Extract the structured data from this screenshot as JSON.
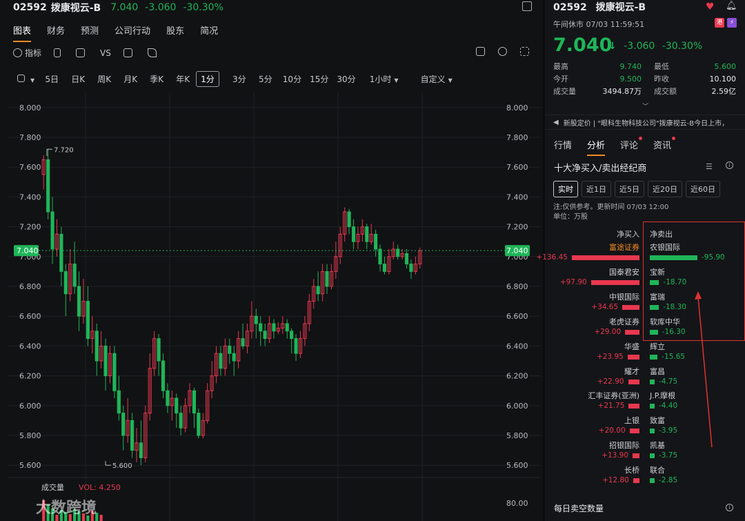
{
  "header": {
    "code": "02592",
    "name": "拨康视云-B",
    "price": "7.040",
    "change": "-3.060",
    "change_pct": "-30.30%"
  },
  "tabs": [
    "图表",
    "财务",
    "预测",
    "公司行动",
    "股东",
    "简况"
  ],
  "toolbar": {
    "indicator": "指标",
    "vs": "VS"
  },
  "periods": {
    "items": [
      "5日",
      "日K",
      "周K",
      "月K",
      "季K",
      "年K",
      "1分",
      "3分",
      "5分",
      "10分",
      "15分",
      "30分",
      "1小时"
    ],
    "active": "1分",
    "custom": "自定义"
  },
  "chart_data": {
    "type": "candlestick",
    "y_ticks": [
      "8.000",
      "7.800",
      "7.600",
      "7.400",
      "7.200",
      "7.000",
      "6.800",
      "6.600",
      "6.400",
      "6.200",
      "6.000",
      "5.800",
      "5.600"
    ],
    "ylim": [
      5.55,
      8.05
    ],
    "last_price_label": "7.040",
    "last_price": 7.04,
    "high_label": "7.720",
    "high": 7.72,
    "low_label": "5.600",
    "low": 5.6,
    "volume_label": "成交量",
    "volume_value": "VOL: 4.250",
    "volume_tick": "80.00",
    "candles": [
      [
        7.55,
        7.65,
        7.68,
        7.45
      ],
      [
        7.65,
        7.3,
        7.72,
        7.25
      ],
      [
        7.3,
        7.05,
        7.4,
        6.95
      ],
      [
        7.05,
        7.15,
        7.25,
        7.0
      ],
      [
        7.15,
        6.9,
        7.2,
        6.8
      ],
      [
        6.9,
        6.75,
        6.95,
        6.6
      ],
      [
        6.75,
        6.95,
        7.05,
        6.7
      ],
      [
        6.95,
        6.8,
        7.1,
        6.75
      ],
      [
        6.8,
        6.6,
        6.9,
        6.5
      ],
      [
        6.6,
        6.7,
        6.85,
        6.55
      ],
      [
        6.7,
        6.45,
        6.8,
        6.4
      ],
      [
        6.45,
        6.5,
        6.6,
        6.35
      ],
      [
        6.5,
        6.3,
        6.55,
        6.2
      ],
      [
        6.3,
        6.4,
        6.5,
        6.25
      ],
      [
        6.4,
        6.2,
        6.45,
        6.1
      ],
      [
        6.2,
        6.35,
        6.4,
        6.15
      ],
      [
        6.35,
        6.1,
        6.4,
        6.05
      ],
      [
        6.1,
        5.95,
        6.2,
        5.9
      ],
      [
        5.95,
        5.8,
        6.0,
        5.7
      ],
      [
        5.8,
        5.9,
        6.05,
        5.75
      ],
      [
        5.9,
        5.7,
        5.95,
        5.65
      ],
      [
        5.7,
        5.75,
        5.85,
        5.62
      ],
      [
        5.75,
        5.65,
        5.9,
        5.6
      ],
      [
        5.65,
        5.95,
        6.0,
        5.62
      ],
      [
        5.95,
        6.25,
        6.35,
        5.9
      ],
      [
        6.25,
        6.45,
        6.5,
        6.2
      ],
      [
        6.45,
        6.3,
        6.48,
        6.2
      ],
      [
        6.3,
        6.1,
        6.35,
        6.05
      ],
      [
        6.1,
        6.0,
        6.15,
        5.95
      ],
      [
        6.0,
        6.05,
        6.1,
        5.9
      ],
      [
        6.05,
        5.95,
        6.08,
        5.85
      ],
      [
        5.95,
        5.85,
        6.0,
        5.8
      ],
      [
        5.85,
        6.0,
        6.05,
        5.82
      ],
      [
        6.0,
        6.1,
        6.15,
        5.95
      ],
      [
        6.1,
        5.95,
        6.12,
        5.85
      ],
      [
        5.95,
        5.8,
        5.98,
        5.78
      ],
      [
        5.8,
        5.9,
        5.95,
        5.78
      ],
      [
        5.9,
        6.1,
        6.15,
        5.88
      ],
      [
        6.1,
        6.2,
        6.3,
        6.05
      ],
      [
        6.2,
        6.35,
        6.4,
        6.15
      ],
      [
        6.35,
        6.25,
        6.4,
        6.2
      ],
      [
        6.25,
        6.4,
        6.45,
        6.2
      ],
      [
        6.4,
        6.35,
        6.45,
        6.28
      ],
      [
        6.35,
        6.3,
        6.4,
        6.2
      ],
      [
        6.3,
        6.45,
        6.5,
        6.25
      ],
      [
        6.45,
        6.4,
        6.55,
        6.38
      ],
      [
        6.4,
        6.5,
        6.55,
        6.35
      ],
      [
        6.5,
        6.6,
        6.7,
        6.45
      ],
      [
        6.6,
        6.55,
        6.65,
        6.45
      ],
      [
        6.55,
        6.5,
        6.6,
        6.4
      ],
      [
        6.5,
        6.45,
        6.55,
        6.4
      ],
      [
        6.45,
        6.55,
        6.6,
        6.42
      ],
      [
        6.55,
        6.5,
        6.58,
        6.45
      ],
      [
        6.5,
        6.52,
        6.56,
        6.48
      ],
      [
        6.52,
        6.55,
        6.6,
        6.48
      ],
      [
        6.55,
        6.5,
        6.58,
        6.45
      ],
      [
        6.5,
        6.45,
        6.52,
        6.35
      ],
      [
        6.45,
        6.35,
        6.48,
        6.3
      ],
      [
        6.35,
        6.45,
        6.5,
        6.32
      ],
      [
        6.45,
        6.55,
        6.6,
        6.4
      ],
      [
        6.55,
        6.7,
        6.75,
        6.5
      ],
      [
        6.7,
        6.8,
        6.85,
        6.65
      ],
      [
        6.8,
        6.75,
        6.9,
        6.7
      ],
      [
        6.75,
        6.9,
        6.95,
        6.7
      ],
      [
        6.9,
        6.8,
        6.95,
        6.75
      ],
      [
        6.8,
        6.9,
        6.95,
        6.78
      ],
      [
        6.9,
        7.0,
        7.1,
        6.85
      ],
      [
        7.0,
        7.15,
        7.2,
        6.95
      ],
      [
        7.15,
        7.3,
        7.33,
        7.1
      ],
      [
        7.3,
        7.2,
        7.32,
        7.15
      ],
      [
        7.2,
        7.1,
        7.25,
        7.05
      ],
      [
        7.1,
        7.15,
        7.2,
        7.05
      ],
      [
        7.15,
        7.2,
        7.25,
        7.1
      ],
      [
        7.2,
        7.1,
        7.22,
        7.05
      ],
      [
        7.1,
        7.15,
        7.22,
        7.08
      ],
      [
        7.15,
        7.05,
        7.18,
        7.0
      ],
      [
        7.05,
        6.95,
        7.08,
        6.9
      ],
      [
        6.95,
        6.9,
        7.0,
        6.88
      ],
      [
        6.9,
        7.0,
        7.05,
        6.88
      ],
      [
        7.0,
        7.05,
        7.1,
        6.98
      ],
      [
        7.05,
        7.0,
        7.08,
        6.98
      ],
      [
        7.0,
        7.02,
        7.05,
        6.98
      ],
      [
        7.02,
        6.95,
        7.05,
        6.92
      ],
      [
        6.95,
        6.9,
        6.98,
        6.85
      ],
      [
        6.9,
        6.95,
        7.0,
        6.88
      ],
      [
        6.95,
        7.04,
        7.06,
        6.92
      ]
    ]
  },
  "right": {
    "code": "02592",
    "name": "拨康视云-B",
    "status": "午间休市 07/03 11:59:51",
    "badge1": "港",
    "badge2": "⚡",
    "price": "7.040",
    "change": "-3.060",
    "change_pct": "-30.30%",
    "stats": [
      {
        "k": "最高",
        "v": "9.740",
        "vc": "green",
        "k2": "最低",
        "v2": "5.600",
        "v2c": "green"
      },
      {
        "k": "今开",
        "v": "9.500",
        "vc": "green",
        "k2": "昨收",
        "v2": "10.100",
        "v2c": "white"
      },
      {
        "k": "成交量",
        "v": "3494.87万",
        "vc": "white",
        "k2": "成交额",
        "v2": "2.59亿",
        "v2c": "white"
      }
    ],
    "news": "新股定价 | \"眼科生物科技公司\"拨康视云-B今日上市，",
    "tabs": [
      "行情",
      "分析",
      "评论",
      "资讯"
    ],
    "active_tab": "分析",
    "section_title": "十大净买入/卖出经纪商",
    "ranges": [
      "实时",
      "近1日",
      "近5日",
      "近20日",
      "近60日"
    ],
    "active_range": "实时",
    "note1": "注:仅供参考。更新时间 07/03 12:00",
    "note2": "单位：万股",
    "buy_header": "净买入",
    "sell_header": "净卖出",
    "buys": [
      {
        "name": "富途证券",
        "value": "+136.45",
        "amount": 136.45,
        "orange": true
      },
      {
        "name": "国泰君安",
        "value": "+97.90",
        "amount": 97.9
      },
      {
        "name": "中银国际",
        "value": "+34.65",
        "amount": 34.65
      },
      {
        "name": "老虎证券",
        "value": "+29.00",
        "amount": 29.0
      },
      {
        "name": "华盛",
        "value": "+23.95",
        "amount": 23.95
      },
      {
        "name": "耀才",
        "value": "+22.90",
        "amount": 22.9
      },
      {
        "name": "汇丰证券(亚洲)",
        "value": "+21.75",
        "amount": 21.75
      },
      {
        "name": "上银",
        "value": "+20.00",
        "amount": 20.0
      },
      {
        "name": "招银国际",
        "value": "+13.90",
        "amount": 13.9
      },
      {
        "name": "长桥",
        "value": "+12.80",
        "amount": 12.8
      }
    ],
    "sells": [
      {
        "name": "农银国际",
        "value": "-95.90",
        "amount": 95.9
      },
      {
        "name": "宝新",
        "value": "-18.70",
        "amount": 18.7
      },
      {
        "name": "富瑞",
        "value": "-18.30",
        "amount": 18.3
      },
      {
        "name": "软库中华",
        "value": "-16.30",
        "amount": 16.3
      },
      {
        "name": "辉立",
        "value": "-15.65",
        "amount": 15.65
      },
      {
        "name": "富昌",
        "value": "-4.75",
        "amount": 4.75
      },
      {
        "name": "J.P.摩根",
        "value": "-4.40",
        "amount": 4.4
      },
      {
        "name": "致富",
        "value": "-3.95",
        "amount": 3.95
      },
      {
        "name": "凯基",
        "value": "-3.75",
        "amount": 3.75
      },
      {
        "name": "联合",
        "value": "-2.85",
        "amount": 2.85
      }
    ],
    "bottom_title": "每日卖空数量"
  },
  "watermark": "大数跨境",
  "colors": {
    "up": "#e8384f",
    "down": "#1fb559",
    "accent": "#f08a24"
  }
}
